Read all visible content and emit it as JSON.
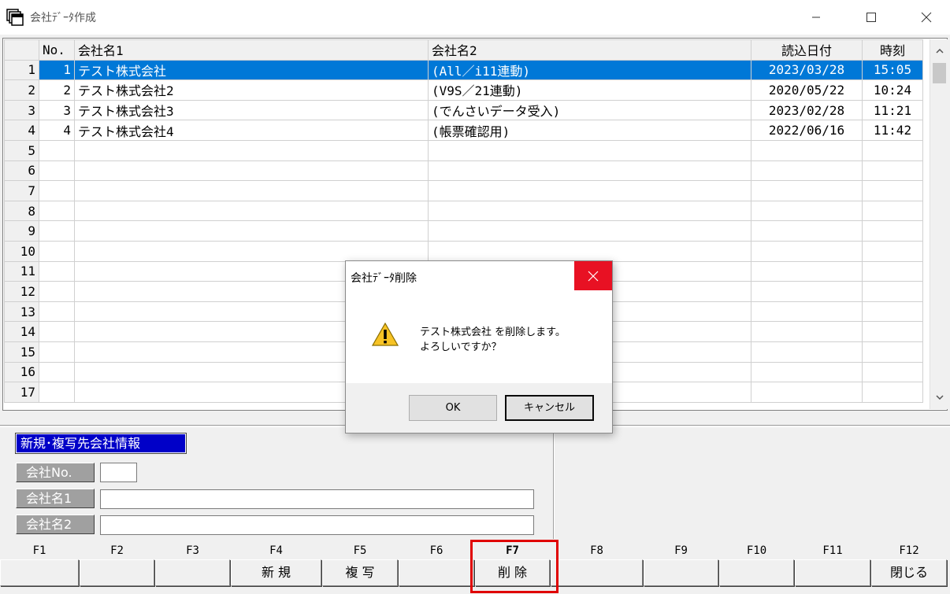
{
  "window": {
    "title": "会社ﾃﾞｰﾀ作成",
    "icon": "app-window-icon"
  },
  "grid": {
    "columns": [
      "No.",
      "会社名1",
      "会社名2",
      "読込日付",
      "時刻"
    ],
    "row_numbers": [
      "1",
      "2",
      "3",
      "4",
      "5",
      "6",
      "7",
      "8",
      "9",
      "10",
      "11",
      "12",
      "13",
      "14",
      "15",
      "16",
      "17"
    ],
    "rows": [
      {
        "no": "1",
        "name1": "テスト株式会社",
        "name2": "(All／i11連動)",
        "date": "2023/03/28",
        "time": "15:05",
        "selected": true
      },
      {
        "no": "2",
        "name1": "テスト株式会社2",
        "name2": "(V9S／21連動)",
        "date": "2020/05/22",
        "time": "10:24",
        "selected": false
      },
      {
        "no": "3",
        "name1": "テスト株式会社3",
        "name2": "(でんさいデータ受入)",
        "date": "2023/02/28",
        "time": "11:21",
        "selected": false
      },
      {
        "no": "4",
        "name1": "テスト株式会社4",
        "name2": "(帳票確認用)",
        "date": "2022/06/16",
        "time": "11:42",
        "selected": false
      }
    ]
  },
  "info_panel": {
    "section_label": "新規･複写先会社情報",
    "fields": [
      {
        "label": "会社No.",
        "value": ""
      },
      {
        "label": "会社名1",
        "value": ""
      },
      {
        "label": "会社名2",
        "value": ""
      }
    ]
  },
  "function_keys": [
    {
      "key": "F1",
      "label": ""
    },
    {
      "key": "F2",
      "label": ""
    },
    {
      "key": "F3",
      "label": ""
    },
    {
      "key": "F4",
      "label": "新 規"
    },
    {
      "key": "F5",
      "label": "複 写"
    },
    {
      "key": "F6",
      "label": ""
    },
    {
      "key": "F7",
      "label": "削 除"
    },
    {
      "key": "F8",
      "label": ""
    },
    {
      "key": "F9",
      "label": ""
    },
    {
      "key": "F10",
      "label": ""
    },
    {
      "key": "F11",
      "label": ""
    },
    {
      "key": "F12",
      "label": "閉じる"
    }
  ],
  "dialog": {
    "title": "会社ﾃﾞｰﾀ削除",
    "message_line1": "テスト株式会社 を削除します。",
    "message_line2": "よろしいですか？",
    "ok_label": "OK",
    "cancel_label": "キャンセル",
    "icon": "warning-icon"
  },
  "colors": {
    "selection": "#0078d7",
    "section_label_bg": "#0000c8",
    "highlight_border": "#e00000",
    "dialog_close": "#e81123"
  }
}
